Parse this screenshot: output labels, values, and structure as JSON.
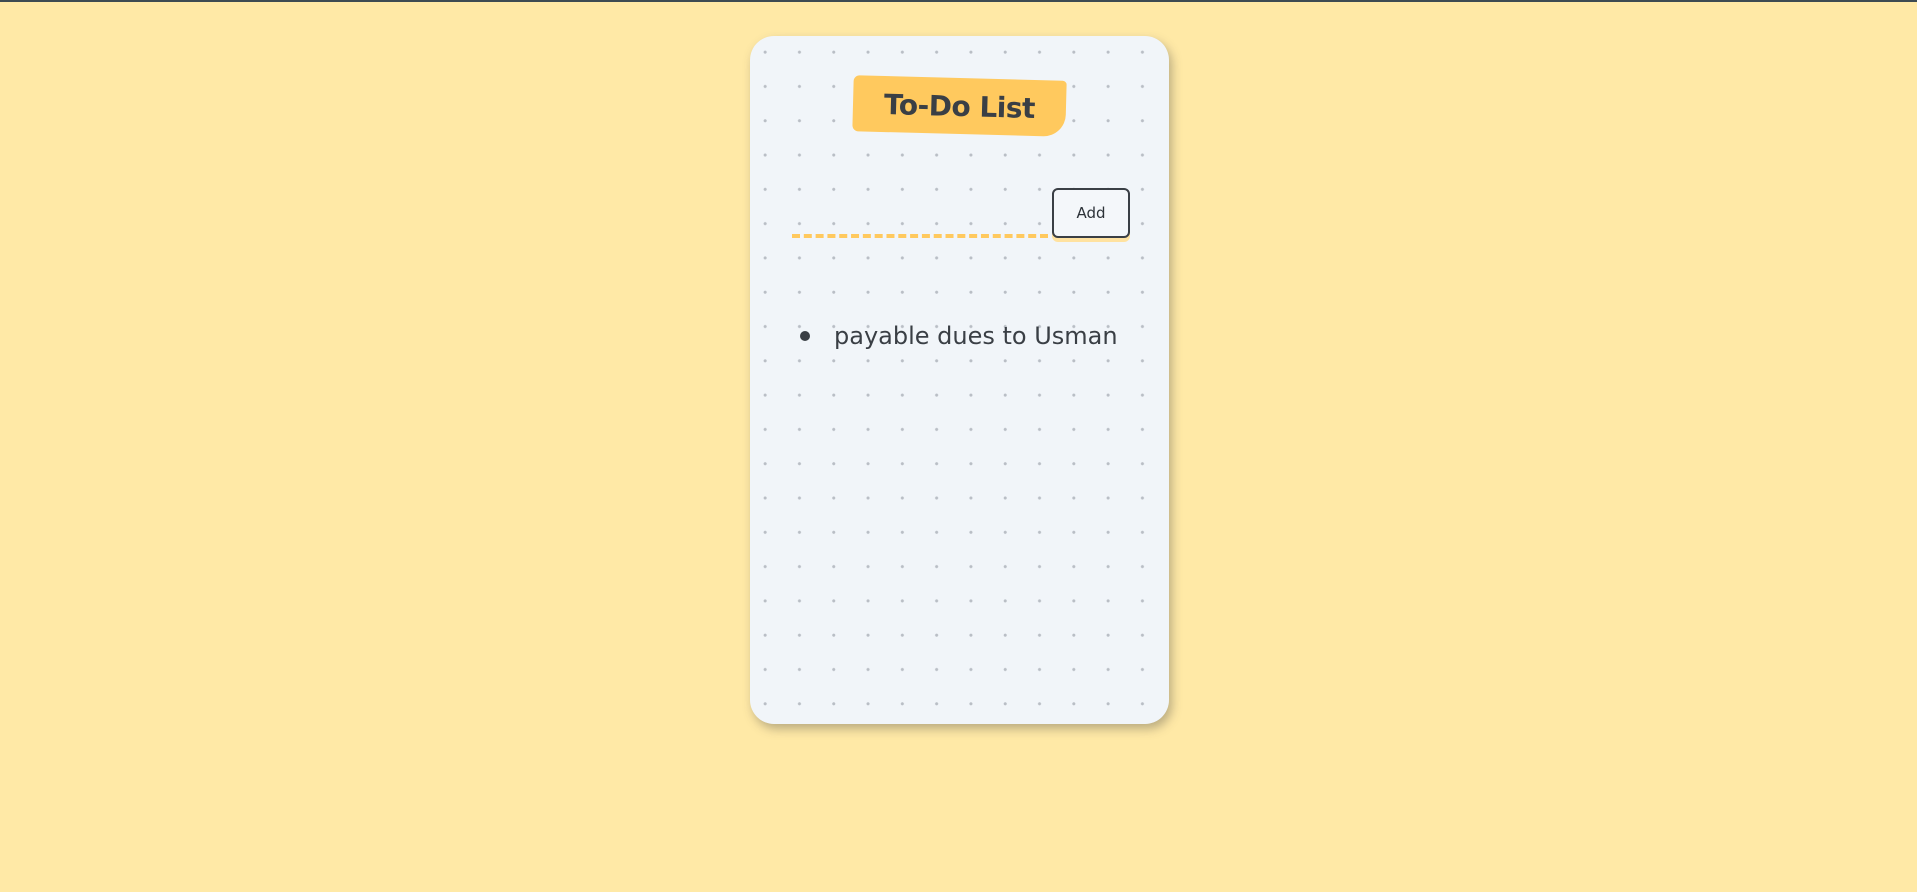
{
  "app": {
    "title": "To-Do List"
  },
  "form": {
    "input_value": "",
    "input_placeholder": "",
    "add_label": "Add"
  },
  "tasks": [
    {
      "text": "payable dues to Usman"
    }
  ],
  "colors": {
    "page_background": "#ffe9a6",
    "card_background": "#f1f5f9",
    "accent": "#ffc95e",
    "text": "#3a3f45"
  }
}
